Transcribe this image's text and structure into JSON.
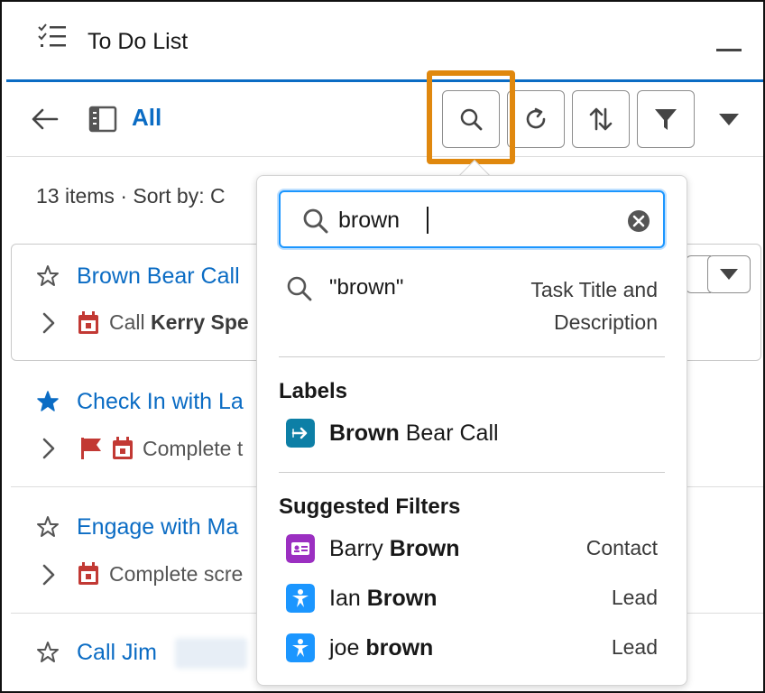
{
  "header": {
    "title": "To Do List",
    "icon": "list-checks-icon"
  },
  "toolbar": {
    "view_label": "All",
    "buttons": [
      "search-icon",
      "refresh-icon",
      "sort-icon",
      "filter-icon",
      "chevron-down-icon"
    ]
  },
  "status": {
    "text": "13 items · Sort by: C"
  },
  "tasks": [
    {
      "title": "Brown Bear Call",
      "starred": false,
      "sub_prefix": "Call ",
      "sub_bold": "Kerry Spe"
    },
    {
      "title": "Check In with La",
      "starred": true,
      "flagged": true,
      "sub_prefix": "Complete t",
      "sub_bold": ""
    },
    {
      "title": "Engage with Ma",
      "starred": false,
      "sub_prefix": "Complete scre",
      "sub_bold": ""
    },
    {
      "title": "Call Jim",
      "starred": false,
      "sub_prefix": "",
      "sub_bold": ""
    }
  ],
  "search": {
    "value": "brown",
    "query_suggestion": "\"brown\"",
    "query_scope": "Task Title and Description",
    "labels_heading": "Labels",
    "label_items": [
      {
        "match": "Brown",
        "rest": " Bear Call",
        "icon": "label-arrow-icon"
      }
    ],
    "filters_heading": "Suggested Filters",
    "filter_items": [
      {
        "pre": "Barry ",
        "match": "Brown",
        "type": "Contact",
        "icon": "contact-icon"
      },
      {
        "pre": "Ian ",
        "match": "Brown",
        "type": "Lead",
        "icon": "lead-icon"
      },
      {
        "pre": "joe ",
        "match": "brown",
        "type": "Lead",
        "icon": "lead-icon"
      }
    ]
  },
  "colors": {
    "brand": "#0b6cc4",
    "highlight": "#e0880e",
    "focus": "#1b96ff",
    "label_icon": "#0d7fa6",
    "contact_icon": "#9b2fc1",
    "lead_icon": "#1b96ff",
    "calendar": "#c23934"
  }
}
